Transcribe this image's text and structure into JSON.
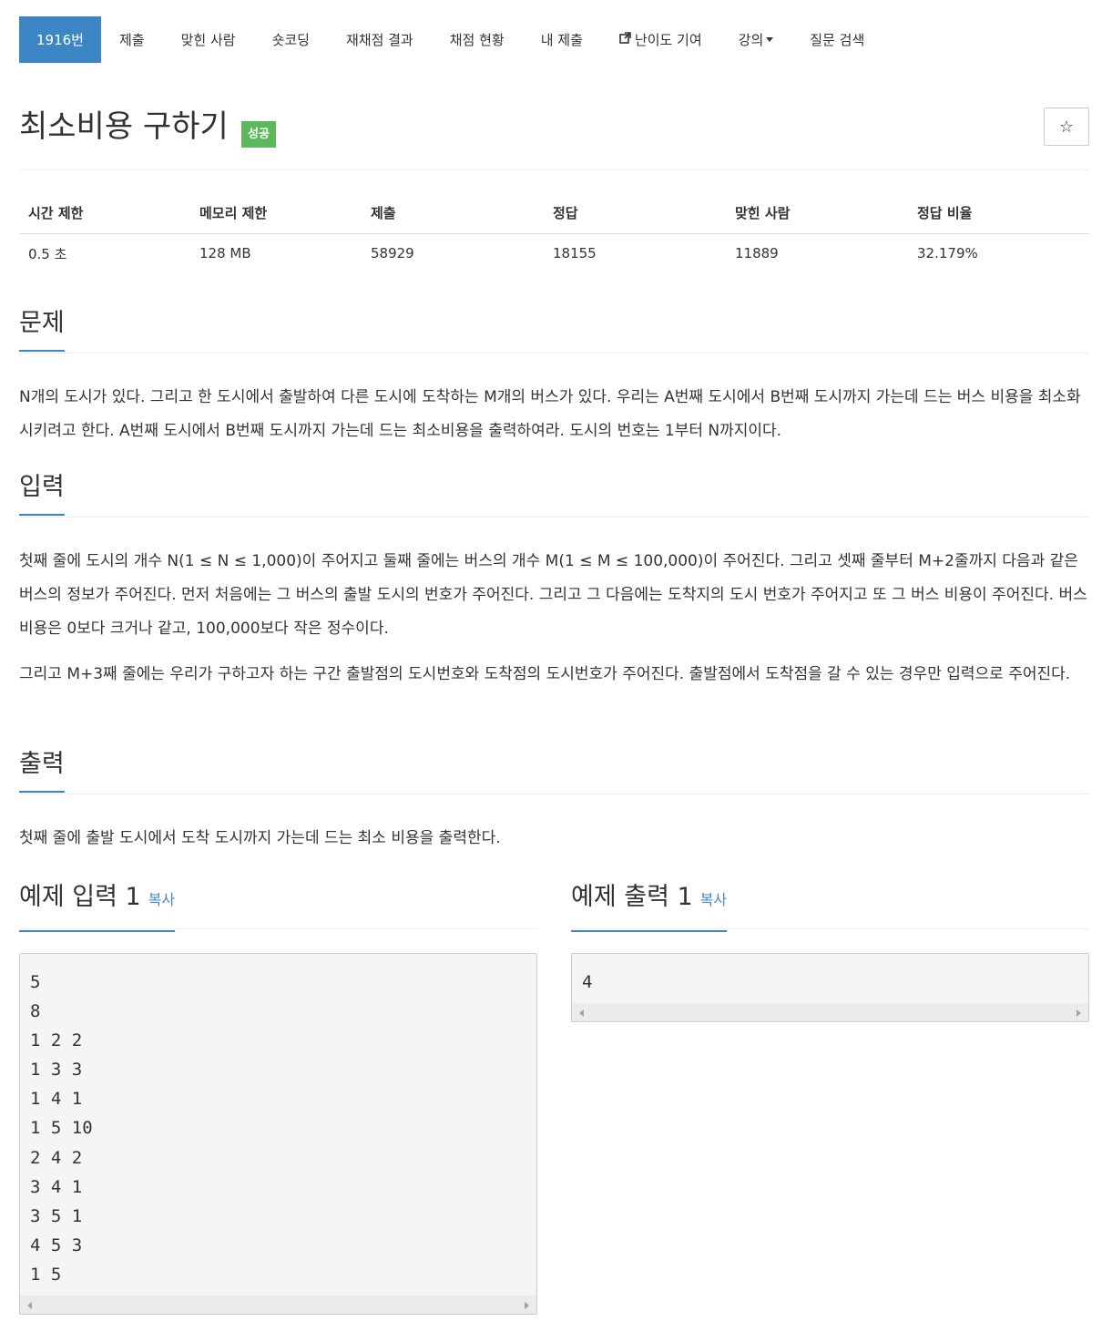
{
  "nav": {
    "items": [
      {
        "label": "1916번"
      },
      {
        "label": "제출"
      },
      {
        "label": "맞힌 사람"
      },
      {
        "label": "숏코딩"
      },
      {
        "label": "재채점 결과"
      },
      {
        "label": "채점 현황"
      },
      {
        "label": "내 제출"
      },
      {
        "label": "난이도 기여"
      },
      {
        "label": "강의"
      },
      {
        "label": "질문 검색"
      }
    ]
  },
  "problem": {
    "title": "최소비용 구하기",
    "status_badge": "성공",
    "star": "☆"
  },
  "info_table": {
    "headers": [
      "시간 제한",
      "메모리 제한",
      "제출",
      "정답",
      "맞힌 사람",
      "정답 비율"
    ],
    "values": [
      "0.5 초",
      "128 MB",
      "58929",
      "18155",
      "11889",
      "32.179%"
    ]
  },
  "sections": {
    "problem_heading": "문제",
    "problem_text": "N개의 도시가 있다. 그리고 한 도시에서 출발하여 다른 도시에 도착하는 M개의 버스가 있다. 우리는 A번째 도시에서 B번째 도시까지 가는데 드는 버스 비용을 최소화 시키려고 한다. A번째 도시에서 B번째 도시까지 가는데 드는 최소비용을 출력하여라. 도시의 번호는 1부터 N까지이다.",
    "input_heading": "입력",
    "input_text_1": "첫째 줄에 도시의 개수 N(1 ≤ N ≤ 1,000)이 주어지고 둘째 줄에는 버스의 개수 M(1 ≤ M ≤ 100,000)이 주어진다. 그리고 셋째 줄부터 M+2줄까지 다음과 같은 버스의 정보가 주어진다. 먼저 처음에는 그 버스의 출발 도시의 번호가 주어진다. 그리고 그 다음에는 도착지의 도시 번호가 주어지고 또 그 버스 비용이 주어진다. 버스 비용은 0보다 크거나 같고, 100,000보다 작은 정수이다.",
    "input_text_2": "그리고 M+3째 줄에는 우리가 구하고자 하는 구간 출발점의 도시번호와 도착점의 도시번호가 주어진다. 출발점에서 도착점을 갈 수 있는 경우만 입력으로 주어진다.",
    "output_heading": "출력",
    "output_text": "첫째 줄에 출발 도시에서 도착 도시까지 가는데 드는 최소 비용을 출력한다."
  },
  "samples": {
    "input_heading": "예제 입력 1",
    "output_heading": "예제 출력 1",
    "copy_label": "복사",
    "input_content": "5\n8\n1 2 2\n1 3 3\n1 4 1\n1 5 10\n2 4 2\n3 4 1\n3 5 1\n4 5 3\n1 5",
    "output_content": "4"
  },
  "colors": {
    "accent": "#3d86c6",
    "success": "#5cb85c",
    "link": "#428bca"
  }
}
